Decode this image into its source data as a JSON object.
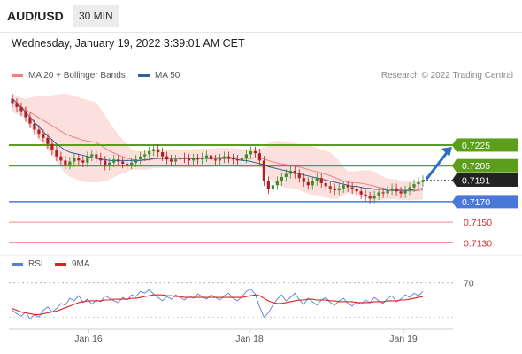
{
  "header": {
    "symbol": "AUD/USD",
    "interval": "30 MIN",
    "datetime": "Wednesday, January 19, 2022 3:39:01 AM CET",
    "copyright": "Research © 2022 Trading Central"
  },
  "legend": {
    "ma20": {
      "label": "MA 20 + Bollinger Bands",
      "color": "#f08080"
    },
    "ma50": {
      "label": "MA 50",
      "color": "#2f5f98"
    },
    "rsi": {
      "label": "RSI",
      "color": "#5b7fd6"
    },
    "rsi_ma": {
      "label": "9MA",
      "color": "#e02020"
    }
  },
  "colors": {
    "resistance": "#5a9e1c",
    "pivot": "#4a78d8",
    "support": "#f08a8a",
    "last": "#222222",
    "arrow": "#2f6fc0",
    "candle_up": "#3d8a2a",
    "candle_down": "#b02020"
  },
  "chart_data": [
    {
      "type": "candlestick",
      "name": "price",
      "xlabel": "",
      "ylabel": "",
      "ylim": [
        0.712,
        0.728
      ],
      "x_ticks": [
        "Jan 16",
        "Jan 18",
        "Jan 19"
      ],
      "levels": [
        {
          "label": "0.7225",
          "value": 0.7225,
          "kind": "resistance"
        },
        {
          "label": "0.7205",
          "value": 0.7205,
          "kind": "resistance"
        },
        {
          "label": "0.7191",
          "value": 0.7191,
          "kind": "last"
        },
        {
          "label": "0.7170",
          "value": 0.717,
          "kind": "pivot"
        },
        {
          "label": "0.7150",
          "value": 0.715,
          "kind": "support"
        },
        {
          "label": "0.7130",
          "value": 0.713,
          "kind": "support"
        }
      ],
      "close": [
        0.7266,
        0.7262,
        0.7258,
        0.7252,
        0.7246,
        0.724,
        0.7236,
        0.7232,
        0.7226,
        0.722,
        0.7214,
        0.721,
        0.7206,
        0.7209,
        0.7212,
        0.721,
        0.7208,
        0.7214,
        0.7216,
        0.7213,
        0.721,
        0.7205,
        0.7208,
        0.7211,
        0.7209,
        0.7207,
        0.7206,
        0.7208,
        0.7211,
        0.7214,
        0.7216,
        0.7219,
        0.7221,
        0.7218,
        0.7214,
        0.7211,
        0.7209,
        0.7211,
        0.7213,
        0.7212,
        0.721,
        0.7212,
        0.7211,
        0.7213,
        0.7215,
        0.7211,
        0.721,
        0.7212,
        0.7214,
        0.7212,
        0.7211,
        0.721,
        0.7212,
        0.7216,
        0.7219,
        0.7217,
        0.721,
        0.719,
        0.7182,
        0.7186,
        0.719,
        0.7194,
        0.7197,
        0.72,
        0.7197,
        0.7193,
        0.7189,
        0.7186,
        0.719,
        0.7193,
        0.7188,
        0.7185,
        0.7183,
        0.7181,
        0.7183,
        0.7186,
        0.7184,
        0.7182,
        0.718,
        0.7177,
        0.7175,
        0.7173,
        0.7176,
        0.7179,
        0.7178,
        0.7181,
        0.7183,
        0.718,
        0.7178,
        0.7181,
        0.7184,
        0.7187,
        0.7189,
        0.7191
      ],
      "ma50": [
        0.727,
        0.7266,
        0.7262,
        0.7257,
        0.7252,
        0.7247,
        0.7243,
        0.7238,
        0.7234,
        0.723,
        0.7226,
        0.7223,
        0.722,
        0.7218,
        0.7217,
        0.7216,
        0.7215,
        0.7214,
        0.7213,
        0.7212,
        0.7211,
        0.7211,
        0.721,
        0.721,
        0.721,
        0.721,
        0.721,
        0.721,
        0.721,
        0.721,
        0.7211,
        0.7211,
        0.7212,
        0.7212,
        0.7212,
        0.7212,
        0.7212,
        0.7212,
        0.7212,
        0.7212,
        0.7212,
        0.7212,
        0.7212,
        0.7212,
        0.7212,
        0.7212,
        0.7212,
        0.7212,
        0.7212,
        0.7212,
        0.7212,
        0.7211,
        0.721,
        0.721,
        0.7209,
        0.7208,
        0.7207,
        0.7206,
        0.7204,
        0.7203,
        0.7202,
        0.7201,
        0.72,
        0.7199,
        0.7198,
        0.7197,
        0.7196,
        0.7195,
        0.7194,
        0.7193,
        0.7192,
        0.7191,
        0.719,
        0.7189,
        0.7188,
        0.7187,
        0.7186,
        0.7185,
        0.7185,
        0.7184,
        0.7183,
        0.7183,
        0.7182,
        0.7182,
        0.7182,
        0.7181,
        0.7181,
        0.7181,
        0.7181,
        0.7181,
        0.7181,
        0.7182,
        0.7182,
        0.7183
      ]
    },
    {
      "type": "line",
      "name": "RSI panel",
      "xlabel": "",
      "ylabel": "",
      "ylim": [
        20,
        80
      ],
      "y_ticks": [
        70
      ],
      "series": [
        {
          "name": "RSI",
          "values": [
            38,
            34,
            31,
            36,
            28,
            33,
            30,
            38,
            42,
            36,
            40,
            46,
            44,
            52,
            49,
            55,
            47,
            51,
            45,
            50,
            48,
            55,
            52,
            49,
            47,
            53,
            50,
            56,
            54,
            60,
            58,
            62,
            57,
            53,
            49,
            54,
            51,
            56,
            53,
            50,
            55,
            52,
            57,
            54,
            51,
            56,
            53,
            50,
            55,
            58,
            52,
            49,
            54,
            60,
            63,
            57,
            42,
            30,
            35,
            44,
            51,
            56,
            49,
            53,
            58,
            50,
            45,
            52,
            48,
            44,
            50,
            53,
            47,
            44,
            49,
            52,
            46,
            43,
            48,
            45,
            50,
            47,
            53,
            49,
            46,
            52,
            55,
            48,
            51,
            56,
            53,
            58,
            55,
            60
          ]
        },
        {
          "name": "9MA",
          "values": [
            40,
            38,
            36,
            35,
            34,
            33,
            33,
            34,
            35,
            36,
            37,
            39,
            41,
            43,
            45,
            47,
            48,
            49,
            49,
            49,
            49,
            50,
            50,
            51,
            51,
            51,
            51,
            52,
            52,
            53,
            54,
            55,
            56,
            56,
            56,
            55,
            55,
            54,
            54,
            53,
            53,
            53,
            53,
            53,
            53,
            53,
            53,
            53,
            53,
            53,
            53,
            53,
            53,
            54,
            55,
            56,
            55,
            52,
            49,
            47,
            46,
            46,
            47,
            48,
            49,
            50,
            50,
            51,
            51,
            50,
            50,
            50,
            49,
            49,
            48,
            48,
            48,
            48,
            47,
            47,
            47,
            47,
            48,
            48,
            48,
            49,
            49,
            49,
            50,
            50,
            51,
            52,
            53,
            54
          ]
        }
      ]
    }
  ]
}
